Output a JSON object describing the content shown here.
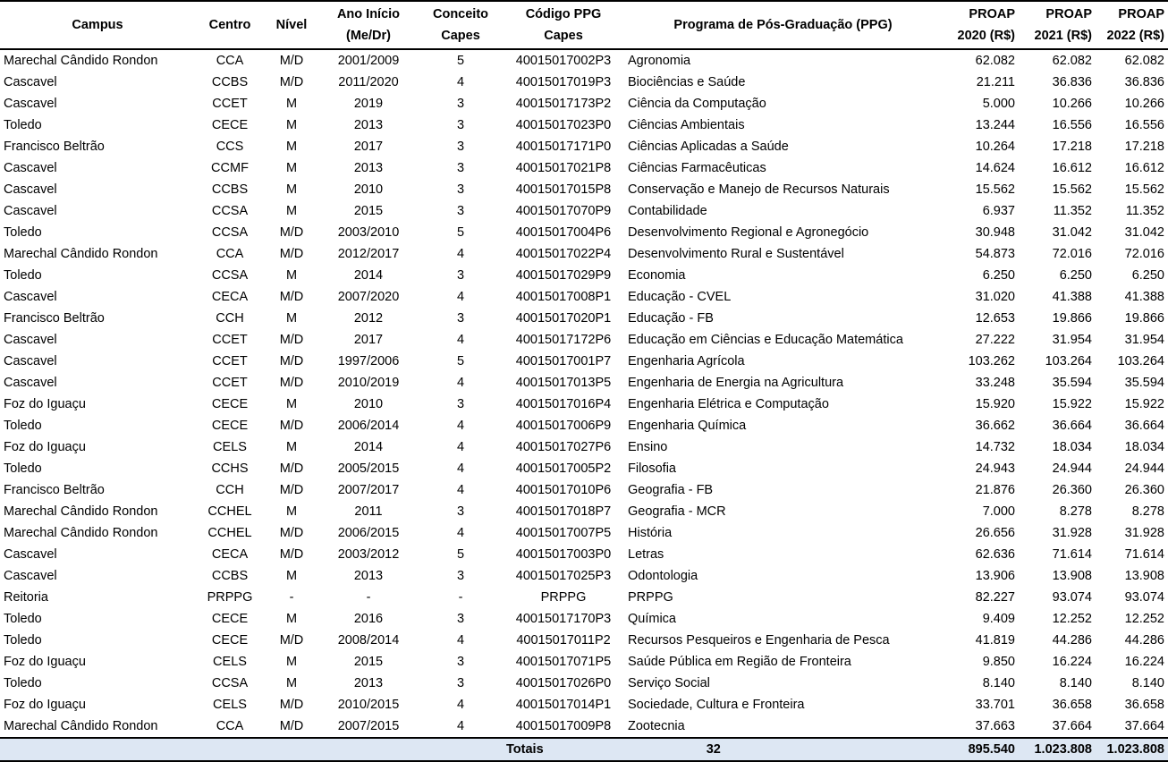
{
  "headers": {
    "campus": "Campus",
    "centro": "Centro",
    "nivel": "Nível",
    "ano_line1": "Ano Início",
    "ano_line2": "(Me/Dr)",
    "conceito_line1": "Conceito",
    "conceito_line2": "Capes",
    "codigo_line1": "Código PPG",
    "codigo_line2": "Capes",
    "programa": "Programa de Pós-Graduação (PPG)",
    "p2020_line1": "PROAP",
    "p2020_line2": "2020 (R$)",
    "p2021_line1": "PROAP",
    "p2021_line2": "2021 (R$)",
    "p2022_line1": "PROAP",
    "p2022_line2": "2022 (R$)"
  },
  "rows": [
    {
      "campus": "Marechal Cândido Rondon",
      "centro": "CCA",
      "nivel": "M/D",
      "ano": "2001/2009",
      "conceito": "5",
      "codigo": "40015017002P3",
      "programa": "Agronomia",
      "p2020": "62.082",
      "p2021": "62.082",
      "p2022": "62.082"
    },
    {
      "campus": "Cascavel",
      "centro": "CCBS",
      "nivel": "M/D",
      "ano": "2011/2020",
      "conceito": "4",
      "codigo": "40015017019P3",
      "programa": "Biociências e Saúde",
      "p2020": "21.211",
      "p2021": "36.836",
      "p2022": "36.836"
    },
    {
      "campus": "Cascavel",
      "centro": "CCET",
      "nivel": "M",
      "ano": "2019",
      "conceito": "3",
      "codigo": "40015017173P2",
      "programa": "Ciência da Computação",
      "p2020": "5.000",
      "p2021": "10.266",
      "p2022": "10.266"
    },
    {
      "campus": "Toledo",
      "centro": "CECE",
      "nivel": "M",
      "ano": "2013",
      "conceito": "3",
      "codigo": "40015017023P0",
      "programa": "Ciências Ambientais",
      "p2020": "13.244",
      "p2021": "16.556",
      "p2022": "16.556"
    },
    {
      "campus": "Francisco Beltrão",
      "centro": "CCS",
      "nivel": "M",
      "ano": "2017",
      "conceito": "3",
      "codigo": "40015017171P0",
      "programa": "Ciências Aplicadas a Saúde",
      "p2020": "10.264",
      "p2021": "17.218",
      "p2022": "17.218"
    },
    {
      "campus": "Cascavel",
      "centro": "CCMF",
      "nivel": "M",
      "ano": "2013",
      "conceito": "3",
      "codigo": "40015017021P8",
      "programa": "Ciências Farmacêuticas",
      "p2020": "14.624",
      "p2021": "16.612",
      "p2022": "16.612"
    },
    {
      "campus": "Cascavel",
      "centro": "CCBS",
      "nivel": "M",
      "ano": "2010",
      "conceito": "3",
      "codigo": "40015017015P8",
      "programa": "Conservação e Manejo de Recursos Naturais",
      "p2020": "15.562",
      "p2021": "15.562",
      "p2022": "15.562"
    },
    {
      "campus": "Cascavel",
      "centro": "CCSA",
      "nivel": "M",
      "ano": "2015",
      "conceito": "3",
      "codigo": "40015017070P9",
      "programa": "Contabilidade",
      "p2020": "6.937",
      "p2021": "11.352",
      "p2022": "11.352"
    },
    {
      "campus": "Toledo",
      "centro": "CCSA",
      "nivel": "M/D",
      "ano": "2003/2010",
      "conceito": "5",
      "codigo": "40015017004P6",
      "programa": "Desenvolvimento Regional e Agronegócio",
      "p2020": "30.948",
      "p2021": "31.042",
      "p2022": "31.042"
    },
    {
      "campus": "Marechal Cândido Rondon",
      "centro": "CCA",
      "nivel": "M/D",
      "ano": "2012/2017",
      "conceito": "4",
      "codigo": "40015017022P4",
      "programa": "Desenvolvimento Rural e Sustentável",
      "p2020": "54.873",
      "p2021": "72.016",
      "p2022": "72.016"
    },
    {
      "campus": "Toledo",
      "centro": "CCSA",
      "nivel": "M",
      "ano": "2014",
      "conceito": "3",
      "codigo": "40015017029P9",
      "programa": "Economia",
      "p2020": "6.250",
      "p2021": "6.250",
      "p2022": "6.250"
    },
    {
      "campus": "Cascavel",
      "centro": "CECA",
      "nivel": "M/D",
      "ano": "2007/2020",
      "conceito": "4",
      "codigo": "40015017008P1",
      "programa": "Educação - CVEL",
      "p2020": "31.020",
      "p2021": "41.388",
      "p2022": "41.388"
    },
    {
      "campus": "Francisco Beltrão",
      "centro": "CCH",
      "nivel": "M",
      "ano": "2012",
      "conceito": "3",
      "codigo": "40015017020P1",
      "programa": "Educação - FB",
      "p2020": "12.653",
      "p2021": "19.866",
      "p2022": "19.866"
    },
    {
      "campus": "Cascavel",
      "centro": "CCET",
      "nivel": "M/D",
      "ano": "2017",
      "conceito": "4",
      "codigo": "40015017172P6",
      "programa": "Educação em Ciências e Educação Matemática",
      "p2020": "27.222",
      "p2021": "31.954",
      "p2022": "31.954"
    },
    {
      "campus": "Cascavel",
      "centro": "CCET",
      "nivel": "M/D",
      "ano": "1997/2006",
      "conceito": "5",
      "codigo": "40015017001P7",
      "programa": "Engenharia Agrícola",
      "p2020": "103.262",
      "p2021": "103.264",
      "p2022": "103.264"
    },
    {
      "campus": "Cascavel",
      "centro": "CCET",
      "nivel": "M/D",
      "ano": "2010/2019",
      "conceito": "4",
      "codigo": "40015017013P5",
      "programa": "Engenharia de Energia na Agricultura",
      "p2020": "33.248",
      "p2021": "35.594",
      "p2022": "35.594"
    },
    {
      "campus": "Foz do Iguaçu",
      "centro": "CECE",
      "nivel": "M",
      "ano": "2010",
      "conceito": "3",
      "codigo": "40015017016P4",
      "programa": "Engenharia Elétrica e Computação",
      "p2020": "15.920",
      "p2021": "15.922",
      "p2022": "15.922"
    },
    {
      "campus": "Toledo",
      "centro": "CECE",
      "nivel": "M/D",
      "ano": "2006/2014",
      "conceito": "4",
      "codigo": "40015017006P9",
      "programa": "Engenharia Química",
      "p2020": "36.662",
      "p2021": "36.664",
      "p2022": "36.664"
    },
    {
      "campus": "Foz do Iguaçu",
      "centro": "CELS",
      "nivel": "M",
      "ano": "2014",
      "conceito": "4",
      "codigo": "40015017027P6",
      "programa": "Ensino",
      "p2020": "14.732",
      "p2021": "18.034",
      "p2022": "18.034"
    },
    {
      "campus": "Toledo",
      "centro": "CCHS",
      "nivel": "M/D",
      "ano": "2005/2015",
      "conceito": "4",
      "codigo": "40015017005P2",
      "programa": "Filosofia",
      "p2020": "24.943",
      "p2021": "24.944",
      "p2022": "24.944"
    },
    {
      "campus": "Francisco Beltrão",
      "centro": "CCH",
      "nivel": "M/D",
      "ano": "2007/2017",
      "conceito": "4",
      "codigo": "40015017010P6",
      "programa": "Geografia - FB",
      "p2020": "21.876",
      "p2021": "26.360",
      "p2022": "26.360"
    },
    {
      "campus": "Marechal Cândido Rondon",
      "centro": "CCHEL",
      "nivel": "M",
      "ano": "2011",
      "conceito": "3",
      "codigo": "40015017018P7",
      "programa": "Geografia - MCR",
      "p2020": "7.000",
      "p2021": "8.278",
      "p2022": "8.278"
    },
    {
      "campus": "Marechal Cândido Rondon",
      "centro": "CCHEL",
      "nivel": "M/D",
      "ano": "2006/2015",
      "conceito": "4",
      "codigo": "40015017007P5",
      "programa": "História",
      "p2020": "26.656",
      "p2021": "31.928",
      "p2022": "31.928"
    },
    {
      "campus": "Cascavel",
      "centro": "CECA",
      "nivel": "M/D",
      "ano": "2003/2012",
      "conceito": "5",
      "codigo": "40015017003P0",
      "programa": "Letras",
      "p2020": "62.636",
      "p2021": "71.614",
      "p2022": "71.614"
    },
    {
      "campus": "Cascavel",
      "centro": "CCBS",
      "nivel": "M",
      "ano": "2013",
      "conceito": "3",
      "codigo": "40015017025P3",
      "programa": "Odontologia",
      "p2020": "13.906",
      "p2021": "13.908",
      "p2022": "13.908"
    },
    {
      "campus": "Reitoria",
      "centro": "PRPPG",
      "nivel": "-",
      "ano": "-",
      "conceito": "-",
      "codigo": "PRPPG",
      "programa": "PRPPG",
      "p2020": "82.227",
      "p2021": "93.074",
      "p2022": "93.074"
    },
    {
      "campus": "Toledo",
      "centro": "CECE",
      "nivel": "M",
      "ano": "2016",
      "conceito": "3",
      "codigo": "40015017170P3",
      "programa": "Química",
      "p2020": "9.409",
      "p2021": "12.252",
      "p2022": "12.252"
    },
    {
      "campus": "Toledo",
      "centro": "CECE",
      "nivel": "M/D",
      "ano": "2008/2014",
      "conceito": "4",
      "codigo": "40015017011P2",
      "programa": "Recursos Pesqueiros e Engenharia de Pesca",
      "p2020": "41.819",
      "p2021": "44.286",
      "p2022": "44.286"
    },
    {
      "campus": "Foz do Iguaçu",
      "centro": "CELS",
      "nivel": "M",
      "ano": "2015",
      "conceito": "3",
      "codigo": "40015017071P5",
      "programa": "Saúde Pública em Região de Fronteira",
      "p2020": "9.850",
      "p2021": "16.224",
      "p2022": "16.224"
    },
    {
      "campus": "Toledo",
      "centro": "CCSA",
      "nivel": "M",
      "ano": "2013",
      "conceito": "3",
      "codigo": "40015017026P0",
      "programa": "Serviço Social",
      "p2020": "8.140",
      "p2021": "8.140",
      "p2022": "8.140"
    },
    {
      "campus": "Foz do Iguaçu",
      "centro": "CELS",
      "nivel": "M/D",
      "ano": "2010/2015",
      "conceito": "4",
      "codigo": "40015017014P1",
      "programa": "Sociedade, Cultura e Fronteira",
      "p2020": "33.701",
      "p2021": "36.658",
      "p2022": "36.658"
    },
    {
      "campus": "Marechal Cândido Rondon",
      "centro": "CCA",
      "nivel": "M/D",
      "ano": "2007/2015",
      "conceito": "4",
      "codigo": "40015017009P8",
      "programa": "Zootecnia",
      "p2020": "37.663",
      "p2021": "37.664",
      "p2022": "37.664"
    }
  ],
  "totals": {
    "label": "Totais",
    "count": "32",
    "p2020": "895.540",
    "p2021": "1.023.808",
    "p2022": "1.023.808"
  },
  "colors": {
    "totals_background": "#dde7f3",
    "border": "#000000"
  }
}
